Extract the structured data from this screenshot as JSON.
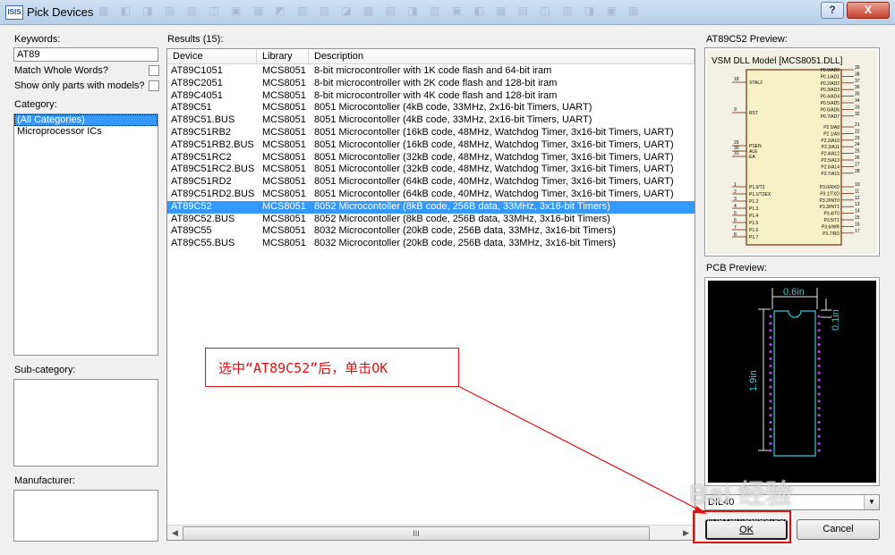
{
  "window": {
    "title": "Pick Devices",
    "app_badge": "ISIS",
    "help": "?",
    "close": "X"
  },
  "left": {
    "keywords_label": "Keywords:",
    "keywords_value": "AT89",
    "match_whole_words": "Match Whole Words?",
    "show_only_models": "Show only parts with models?",
    "category_label": "Category:",
    "categories": [
      {
        "label": "(All Categories)",
        "selected": true
      },
      {
        "label": "Microprocessor ICs",
        "selected": false
      }
    ],
    "subcategory_label": "Sub-category:",
    "manufacturer_label": "Manufacturer:"
  },
  "results": {
    "label": "Results (15):",
    "columns": [
      "Device",
      "Library",
      "Description"
    ],
    "rows": [
      {
        "device": "AT89C1051",
        "library": "MCS8051",
        "description": "8-bit microcontroller with 1K code flash and 64-bit iram"
      },
      {
        "device": "AT89C2051",
        "library": "MCS8051",
        "description": "8-bit microcontroller with 2K code flash and 128-bit iram"
      },
      {
        "device": "AT89C4051",
        "library": "MCS8051",
        "description": "8-bit microcontroller with 4K code flash and 128-bit iram"
      },
      {
        "device": "AT89C51",
        "library": "MCS8051",
        "description": "8051 Microcontoller (4kB code, 33MHz, 2x16-bit Timers, UART)"
      },
      {
        "device": "AT89C51.BUS",
        "library": "MCS8051",
        "description": "8051 Microcontoller (4kB code, 33MHz, 2x16-bit Timers, UART)"
      },
      {
        "device": "AT89C51RB2",
        "library": "MCS8051",
        "description": "8051 Microcontoller (16kB code, 48MHz, Watchdog Timer, 3x16-bit Timers, UART)"
      },
      {
        "device": "AT89C51RB2.BUS",
        "library": "MCS8051",
        "description": "8051 Microcontoller (16kB code, 48MHz, Watchdog Timer, 3x16-bit Timers, UART)"
      },
      {
        "device": "AT89C51RC2",
        "library": "MCS8051",
        "description": "8051 Microcontoller (32kB code, 48MHz, Watchdog Timer, 3x16-bit Timers, UART)"
      },
      {
        "device": "AT89C51RC2.BUS",
        "library": "MCS8051",
        "description": "8051 Microcontoller (32kB code, 48MHz, Watchdog Timer, 3x16-bit Timers, UART)"
      },
      {
        "device": "AT89C51RD2",
        "library": "MCS8051",
        "description": "8051 Microcontoller (64kB code, 40MHz, Watchdog Timer, 3x16-bit Timers, UART)"
      },
      {
        "device": "AT89C51RD2.BUS",
        "library": "MCS8051",
        "description": "8051 Microcontoller (64kB code, 40MHz, Watchdog Timer, 3x16-bit Timers, UART)"
      },
      {
        "device": "AT89C52",
        "library": "MCS8051",
        "description": "8052 Microcontoller (8kB code, 256B data, 33MHz, 3x16-bit Timers)",
        "selected": true
      },
      {
        "device": "AT89C52.BUS",
        "library": "MCS8051",
        "description": "8052 Microcontoller (8kB code, 256B data, 33MHz, 3x16-bit Timers)"
      },
      {
        "device": "AT89C55",
        "library": "MCS8051",
        "description": "8032 Microcontoller (20kB code, 256B data, 33MHz, 3x16-bit Timers)"
      },
      {
        "device": "AT89C55.BUS",
        "library": "MCS8051",
        "description": "8032 Microcontoller (20kB code, 256B data, 33MHz, 3x16-bit Timers)"
      }
    ],
    "scroll_grip": "III"
  },
  "preview": {
    "schematic_label": "AT89C52 Preview:",
    "schematic_title": "VSM DLL Model [MCS8051.DLL]",
    "schematic_left_pins": [
      {
        "num": "18",
        "name": "XTAL2"
      },
      {
        "num": "9",
        "name": "RST"
      },
      {
        "num": "29",
        "name": "PSEN"
      },
      {
        "num": "30",
        "name": "ALE"
      },
      {
        "num": "31",
        "name": "EA"
      }
    ],
    "schematic_p1": [
      "P1.0/T2",
      "P1.1/T2EX",
      "P1.2",
      "P1.3",
      "P1.4",
      "P1.5",
      "P1.6",
      "P1.7"
    ],
    "schematic_p1_nums": [
      "1",
      "2",
      "3",
      "4",
      "5",
      "6",
      "7",
      "8"
    ],
    "schematic_p0": [
      "P0.0/AD0",
      "P0.1/AD1",
      "P0.2/AD2",
      "P0.3/AD3",
      "P0.4/AD4",
      "P0.5/AD5",
      "P0.6/AD6",
      "P0.7/AD7"
    ],
    "schematic_p0_nums": [
      "39",
      "38",
      "37",
      "36",
      "35",
      "34",
      "33",
      "32"
    ],
    "schematic_p2": [
      "P2.0/A8",
      "P2.1/A9",
      "P2.2/A10",
      "P2.3/A11",
      "P2.4/A12",
      "P2.5/A13",
      "P2.6/A14",
      "P2.7/A15"
    ],
    "schematic_p2_nums": [
      "21",
      "22",
      "23",
      "24",
      "25",
      "26",
      "27",
      "28"
    ],
    "schematic_p3": [
      "P3.0/RXD",
      "P3.1/TXD",
      "P3.2/INT0",
      "P3.3/INT1",
      "P3.4/T0",
      "P3.5/T1",
      "P3.6/WR",
      "P3.7/RD"
    ],
    "schematic_p3_nums": [
      "10",
      "11",
      "12",
      "13",
      "14",
      "15",
      "16",
      "17"
    ],
    "pcb_label": "PCB Preview:",
    "pcb_width": "0.6in",
    "pcb_pitch": "0.1in",
    "pcb_length": "1.9in",
    "package_value": "DIL40"
  },
  "buttons": {
    "ok": "OK",
    "cancel": "Cancel"
  },
  "annotation": {
    "text": "选中“AT89C52”后，单击OK",
    "color": "#e01010"
  },
  "watermark": {
    "text": "Bai 经验",
    "url": "jingyan.baidu.com"
  }
}
